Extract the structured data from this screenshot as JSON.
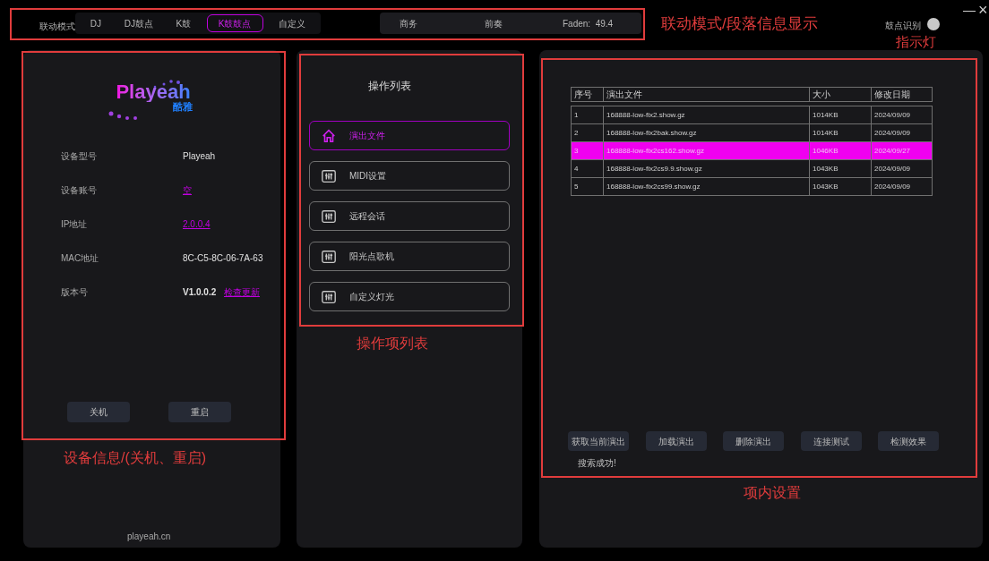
{
  "top_bar": {
    "mode_label": "联动模式",
    "modes": [
      {
        "label": "DJ",
        "selected": false
      },
      {
        "label": "DJ鼓点",
        "selected": false
      },
      {
        "label": "K鼓",
        "selected": false
      },
      {
        "label": "K鼓鼓点",
        "selected": true
      },
      {
        "label": "自定义",
        "selected": false
      }
    ],
    "segment_info": [
      "商务",
      "前奏",
      "Faden:  49.4"
    ],
    "indicator": {
      "label": "鼓点识别",
      "on": false
    },
    "window_controls": [
      "—",
      "×"
    ]
  },
  "device_panel": {
    "logo": {
      "wordmark": "Playeah",
      "subtitle": "酷雅"
    },
    "fields": [
      {
        "label": "设备型号",
        "value": "Playeah",
        "kind": "plain"
      },
      {
        "label": "设备账号",
        "value": "空",
        "kind": "link"
      },
      {
        "label": "IP地址",
        "value": "2.0.0.4",
        "kind": "link"
      },
      {
        "label": "MAC地址",
        "value": "8C-C5-8C-06-7A-63",
        "kind": "plain"
      },
      {
        "label": "版本号",
        "value": "V1.0.0.2",
        "kind": "version",
        "link": "检查更新"
      }
    ],
    "buttons": [
      "关机",
      "重启"
    ],
    "footer": "playeah.cn"
  },
  "operations_panel": {
    "title": "操作列表",
    "items": [
      {
        "label": "演出文件",
        "kind": "home",
        "selected": true
      },
      {
        "label": "MIDI设置",
        "kind": "settings",
        "selected": false
      },
      {
        "label": "远程会话",
        "kind": "settings",
        "selected": false
      },
      {
        "label": "阳光点歌机",
        "kind": "settings",
        "selected": false
      },
      {
        "label": "自定义灯光",
        "kind": "settings",
        "selected": false
      }
    ]
  },
  "files_panel": {
    "table": {
      "columns": [
        "序号",
        "演出文件",
        "大小",
        "修改日期"
      ],
      "rows": [
        {
          "cells": [
            "1",
            "168888-low-fix2.show.gz",
            "1014KB",
            "2024/09/09"
          ],
          "selected": false
        },
        {
          "cells": [
            "2",
            "168888-low-fix2bak.show.gz",
            "1014KB",
            "2024/09/09"
          ],
          "selected": false
        },
        {
          "cells": [
            "3",
            "168888-low-fix2cs162.show.gz",
            "1046KB",
            "2024/09/27"
          ],
          "selected": true
        },
        {
          "cells": [
            "4",
            "168888-low-fix2cs9.9.show.gz",
            "1043KB",
            "2024/09/09"
          ],
          "selected": false
        },
        {
          "cells": [
            "5",
            "168888-low-fix2cs99.show.gz",
            "1043KB",
            "2024/09/09"
          ],
          "selected": false
        }
      ]
    },
    "buttons": [
      "获取当前演出",
      "加载演出",
      "删除演出",
      "连接测试",
      "检测效果"
    ],
    "status": "搜索成功!"
  },
  "annotations": [
    "联动模式/段落信息显示",
    "指示灯",
    "设备信息/(关机、重启)",
    "操作项列表",
    "项内设置"
  ]
}
